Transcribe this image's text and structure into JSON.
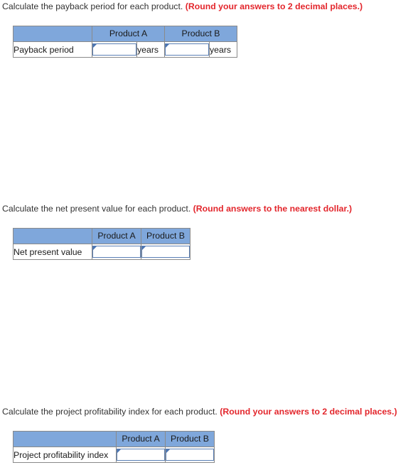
{
  "page": {
    "note_color": "#e3262c",
    "header_fill": "#7fa7db",
    "input_border": "#5b80b6",
    "table_border": "#8a8a8a"
  },
  "sections": [
    {
      "id": "payback",
      "prompt_text": "Calculate the payback period for each product. ",
      "prompt_note": "(Round your answers to 2 decimal places.)",
      "table": {
        "corner_header": "",
        "column_headers": [
          "Product A",
          "Product B"
        ],
        "row_label": "Payback period",
        "inputs": [
          {
            "value": "",
            "placeholder": ""
          },
          {
            "value": "",
            "placeholder": ""
          }
        ],
        "units": [
          "years",
          "years"
        ]
      }
    },
    {
      "id": "npv",
      "prompt_text": "Calculate the net present value for each product. ",
      "prompt_note": "(Round answers to the nearest dollar.)",
      "table": {
        "corner_header": "",
        "column_headers": [
          "Product A",
          "Product B"
        ],
        "row_label": "Net present value",
        "inputs": [
          {
            "value": "",
            "placeholder": ""
          },
          {
            "value": "",
            "placeholder": ""
          }
        ],
        "units": []
      }
    },
    {
      "id": "ppi",
      "prompt_text": "Calculate the project profitability index for each product. ",
      "prompt_note": "(Round your answers to 2 decimal places.)",
      "table": {
        "corner_header": "",
        "column_headers": [
          "Product A",
          "Product B"
        ],
        "row_label": "Project profitability index",
        "inputs": [
          {
            "value": "",
            "placeholder": ""
          },
          {
            "value": "",
            "placeholder": ""
          }
        ],
        "units": []
      }
    }
  ]
}
